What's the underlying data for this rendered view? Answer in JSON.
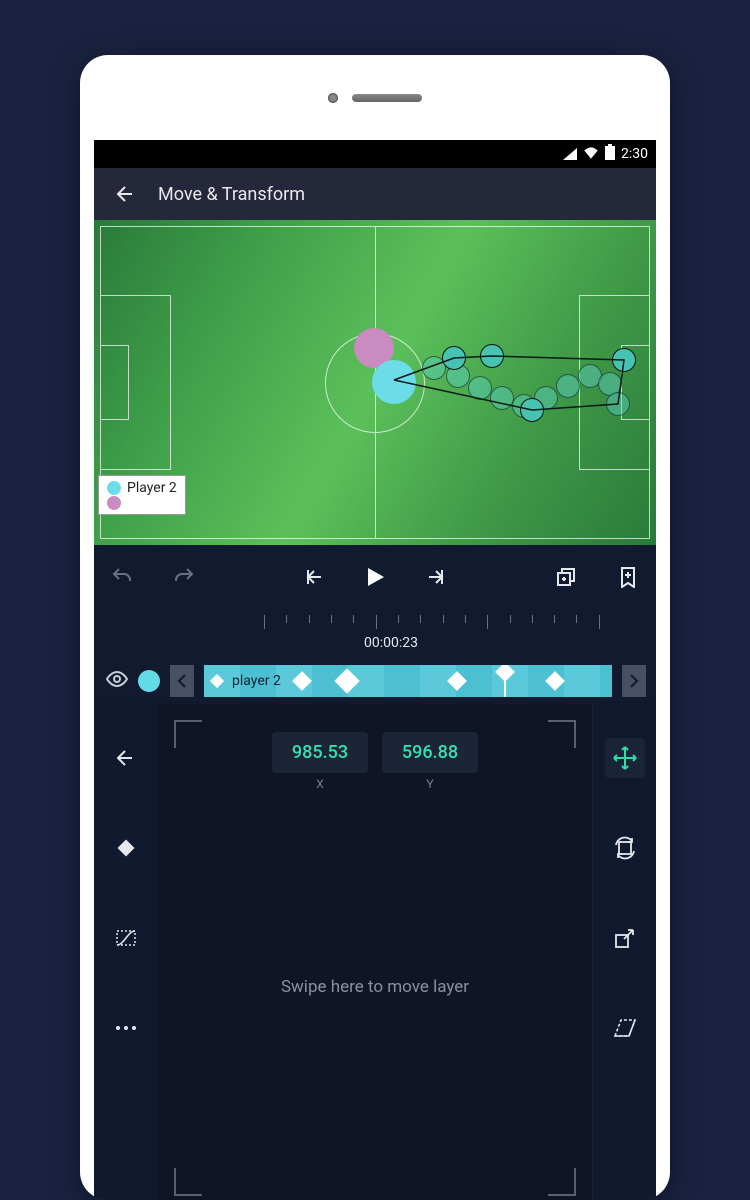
{
  "statusbar": {
    "time": "2:30"
  },
  "appbar": {
    "title": "Move & Transform"
  },
  "legend": {
    "player2_label": "Player 2",
    "player2_color": "#6bdce8",
    "player1_color": "#c98bc0"
  },
  "timeline": {
    "timecode": "00:00:23",
    "clip_label": "player 2"
  },
  "transform": {
    "x_value": "985.53",
    "y_value": "596.88",
    "x_label": "X",
    "y_label": "Y",
    "hint": "Swipe here to move layer"
  },
  "icons": {
    "back": "back-arrow",
    "undo": "undo",
    "redo": "redo",
    "prev_key": "prev-keyframe",
    "play": "play",
    "next_key": "next-keyframe",
    "duplicate": "duplicate",
    "bookmark": "bookmark-add",
    "visibility": "eye",
    "move": "move",
    "rotate": "rotate",
    "scale": "scale",
    "skew": "skew",
    "keyframe_tool": "keyframe",
    "easing": "easing",
    "more": "more"
  }
}
